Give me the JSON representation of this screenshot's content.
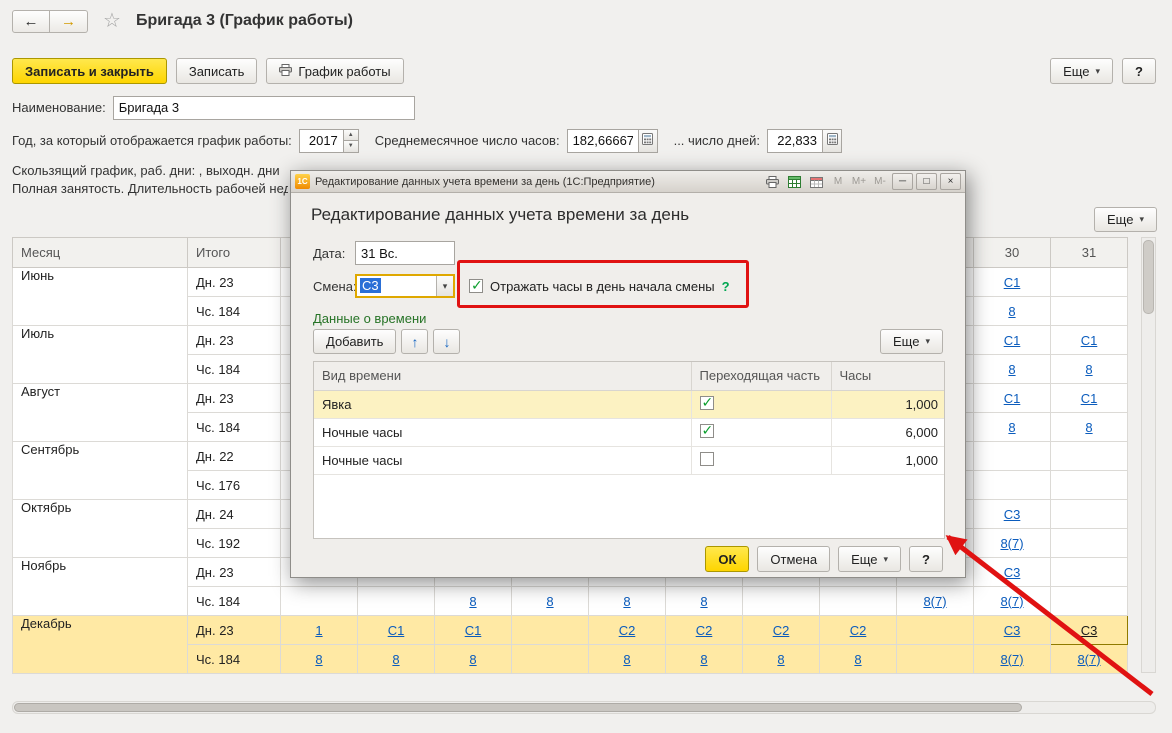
{
  "colors": {
    "accent_yellow": "#fed500",
    "link_blue": "#0b5cbd",
    "annotation_red": "#e01212",
    "check_green": "#0b9e2d",
    "group_green": "#267326",
    "row_highlight": "#ffe9a4",
    "selected_cell": "#c5a418"
  },
  "ui": {
    "back_icon": "←",
    "forward_icon": "→",
    "star_icon": "☆",
    "caret": "▾",
    "spin_up": "▲",
    "spin_down": "▼",
    "up_arrow": "↑",
    "down_arrow": "↓",
    "minimize": "─",
    "maximize": "□",
    "close": "×"
  },
  "app": {
    "title": "Бригада 3 (График работы)"
  },
  "toolbar": {
    "save_and_close": "Записать и закрыть",
    "save": "Записать",
    "work_schedule": "График работы",
    "more": "Еще",
    "help": "?"
  },
  "fields": {
    "name_label": "Наименование:",
    "name_value": "Бригада 3",
    "year_label": "Год, за который отображается график работы:",
    "year_value": "2017",
    "avg_hours_label": "Среднемесячное число часов:",
    "avg_hours_value": "182,66667",
    "avg_days_label": "... число дней:",
    "avg_days_value": "22,833",
    "info_line1": "Скользящий график, раб. дни: , выходн. дни",
    "info_line2": "Полная занятость. Длительность рабочей нед",
    "table_more": "Еще"
  },
  "schedule": {
    "columns": {
      "month": "Месяц",
      "total": "Итого"
    },
    "day_headers": [
      "",
      "",
      "",
      "",
      "",
      "",
      "",
      "",
      "",
      "30",
      "31"
    ],
    "rows": [
      {
        "month": "Июнь",
        "highlight": false,
        "days_total": "Дн. 23",
        "hours_total": "Чс. 184",
        "days_cells": [
          "",
          "",
          "",
          "",
          "",
          "",
          "",
          "",
          "",
          "С1",
          ""
        ],
        "hours_cells": [
          "",
          "",
          "",
          "",
          "",
          "",
          "",
          "",
          "",
          "8",
          ""
        ]
      },
      {
        "month": "Июль",
        "highlight": false,
        "days_total": "Дн. 23",
        "hours_total": "Чс. 184",
        "days_cells": [
          "",
          "",
          "",
          "",
          "",
          "",
          "",
          "",
          "",
          "С1",
          "С1"
        ],
        "hours_cells": [
          "",
          "",
          "",
          "",
          "",
          "",
          "",
          "",
          "",
          "8",
          "8"
        ]
      },
      {
        "month": "Август",
        "highlight": false,
        "days_total": "Дн. 23",
        "hours_total": "Чс. 184",
        "days_cells": [
          "",
          "",
          "",
          "",
          "",
          "",
          "",
          "",
          "",
          "С1",
          "С1"
        ],
        "hours_cells": [
          "",
          "",
          "",
          "",
          "",
          "",
          "",
          "",
          "",
          "8",
          "8"
        ]
      },
      {
        "month": "Сентябрь",
        "highlight": false,
        "days_total": "Дн. 22",
        "hours_total": "Чс. 176",
        "days_cells": [
          "",
          "",
          "",
          "",
          "",
          "",
          "",
          "",
          "",
          "",
          ""
        ],
        "hours_cells": [
          "",
          "",
          "",
          "",
          "",
          "",
          "",
          "",
          "",
          "",
          ""
        ]
      },
      {
        "month": "Октябрь",
        "highlight": false,
        "days_total": "Дн. 24",
        "hours_total": "Чс. 192",
        "days_cells": [
          "",
          "",
          "",
          "",
          "",
          "",
          "",
          "",
          "",
          "С3",
          ""
        ],
        "hours_cells": [
          "",
          "",
          "",
          "",
          "",
          "",
          "",
          "",
          "",
          "8(7)",
          ""
        ]
      },
      {
        "month": "Ноябрь",
        "highlight": false,
        "days_total": "Дн. 23",
        "hours_total": "Чс. 184",
        "days_cells": [
          "",
          "",
          "",
          "",
          "",
          "",
          "",
          "",
          "",
          "С3",
          ""
        ],
        "hours_cells": [
          "",
          "",
          "8",
          "8",
          "8",
          "8",
          "",
          "",
          "8(7)",
          "8(7)",
          ""
        ]
      },
      {
        "month": "Декабрь",
        "highlight": true,
        "days_total": "Дн. 23",
        "hours_total": "Чс. 184",
        "days_cells": [
          "1",
          "С1",
          "С1",
          "",
          "С2",
          "С2",
          "С2",
          "С2",
          "",
          "С3",
          "С3"
        ],
        "hours_cells": [
          "8",
          "8",
          "8",
          "",
          "8",
          "8",
          "8",
          "8",
          "",
          "8(7)",
          "8(7)"
        ],
        "selected_day_index": 10
      }
    ]
  },
  "dialog": {
    "titlebar": {
      "logo": "1С",
      "title": "Редактирование данных учета времени за день (1С:Предприятие)",
      "mem_buttons": [
        "М",
        "М+",
        "М-"
      ]
    },
    "heading": "Редактирование данных учета времени за день",
    "date_label": "Дата:",
    "date_value": "31 Вс.",
    "shift_label": "Смена:",
    "shift_value": "С3",
    "checkbox_label": "Отражать часы в день начала смены",
    "checkbox_help": "?",
    "group_label": "Данные о времени",
    "add_button": "Добавить",
    "more": "Еще",
    "table": {
      "headers": [
        "Вид времени",
        "Переходящая часть",
        "Часы"
      ],
      "rows": [
        {
          "type": "Явка",
          "carry": true,
          "hours": "1,000",
          "highlight": true
        },
        {
          "type": "Ночные часы",
          "carry": true,
          "hours": "6,000",
          "highlight": false
        },
        {
          "type": "Ночные часы",
          "carry": false,
          "hours": "1,000",
          "highlight": false
        }
      ]
    },
    "buttons": {
      "ok": "ОК",
      "cancel": "Отмена",
      "more": "Еще",
      "help": "?"
    }
  }
}
